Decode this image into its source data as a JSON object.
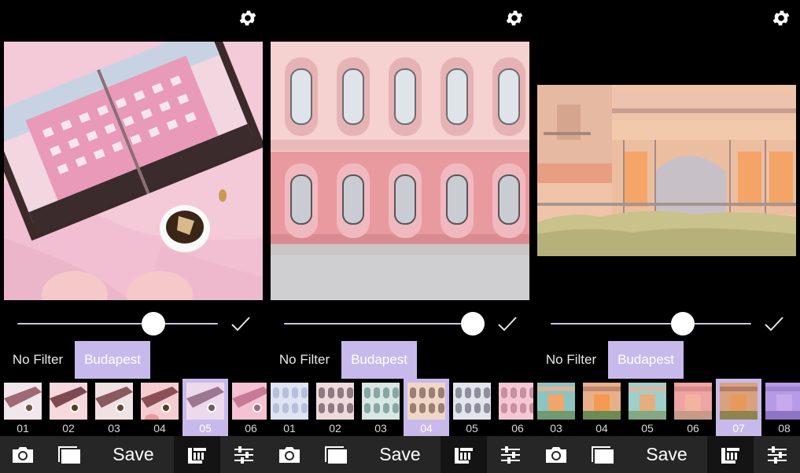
{
  "panels": [
    {
      "no_filter_label": "No Filter",
      "active_filter_label": "Budapest",
      "intensity": 0.68,
      "photo": "grand-budapest-book-with-tea",
      "thumbnails": [
        {
          "num": "01",
          "selected": false
        },
        {
          "num": "02",
          "selected": false
        },
        {
          "num": "03",
          "selected": false
        },
        {
          "num": "04",
          "selected": false
        },
        {
          "num": "05",
          "selected": true
        },
        {
          "num": "06",
          "selected": false
        }
      ],
      "toolbar": {
        "save_label": "Save"
      }
    },
    {
      "no_filter_label": "No Filter",
      "active_filter_label": "Budapest",
      "intensity": 0.94,
      "photo": "pink-building-facade",
      "thumbnails": [
        {
          "num": "01",
          "selected": false
        },
        {
          "num": "02",
          "selected": false
        },
        {
          "num": "03",
          "selected": false
        },
        {
          "num": "04",
          "selected": true
        },
        {
          "num": "05",
          "selected": false
        },
        {
          "num": "06",
          "selected": false
        }
      ],
      "toolbar": {
        "save_label": "Save"
      }
    },
    {
      "no_filter_label": "No Filter",
      "active_filter_label": "Budapest",
      "intensity": 0.66,
      "photo": "terrace-hotel",
      "thumbnails": [
        {
          "num": "03",
          "selected": false
        },
        {
          "num": "04",
          "selected": false
        },
        {
          "num": "05",
          "selected": false
        },
        {
          "num": "06",
          "selected": false
        },
        {
          "num": "07",
          "selected": true
        },
        {
          "num": "08",
          "selected": false
        }
      ],
      "toolbar": {
        "save_label": "Save"
      }
    }
  ],
  "icons": {
    "settings": "gear-icon",
    "confirm": "checkmark-icon",
    "camera": "camera-icon",
    "gallery": "gallery-icon",
    "filters": "film-strip-icon",
    "adjust": "sliders-icon"
  },
  "colors": {
    "accent": "#c8b9ec",
    "slider_track": "#cfc4ea",
    "toolbar_bg": "#262626",
    "toolbar_active_bg": "#141414"
  }
}
